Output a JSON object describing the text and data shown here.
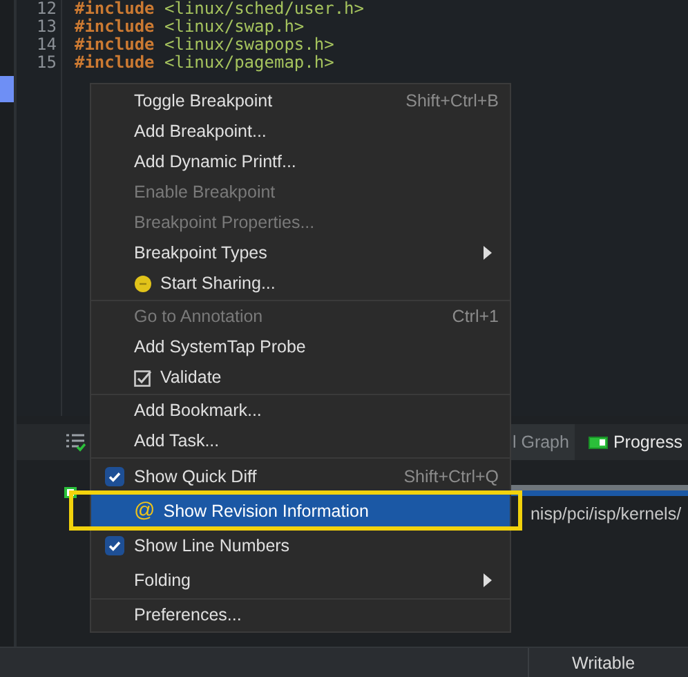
{
  "code_lines": [
    {
      "number": "12",
      "keyword": "#include",
      "path": "<linux/sched/user.h>"
    },
    {
      "number": "13",
      "keyword": "#include",
      "path": "<linux/swap.h>"
    },
    {
      "number": "14",
      "keyword": "#include",
      "path": "<linux/swapops.h>"
    },
    {
      "number": "15",
      "keyword": "#include",
      "path": "<linux/pagemap.h>"
    }
  ],
  "bottom_panel": {
    "tabs": [
      {
        "label": "l Graph",
        "selected": false
      },
      {
        "label": "Progress",
        "selected": true,
        "icon": true
      }
    ],
    "path": "nisp/pci/isp/kernels/"
  },
  "context_menu": [
    {
      "kind": "item",
      "label": "Toggle Breakpoint",
      "shortcut": "Shift+Ctrl+B",
      "disabled": false,
      "selected": false
    },
    {
      "kind": "item",
      "label": "Add Breakpoint...",
      "disabled": false,
      "selected": false
    },
    {
      "kind": "item",
      "label": "Add Dynamic Printf...",
      "disabled": false,
      "selected": false
    },
    {
      "kind": "item",
      "label": "Enable Breakpoint",
      "disabled": true,
      "selected": false
    },
    {
      "kind": "item",
      "label": "Breakpoint Properties...",
      "disabled": true,
      "selected": false
    },
    {
      "kind": "submenu",
      "label": "Breakpoint Types",
      "disabled": false,
      "selected": false
    },
    {
      "kind": "sharing",
      "label": "Start Sharing...",
      "disabled": false,
      "selected": false,
      "separator_after": true
    },
    {
      "kind": "item",
      "label": "Go to Annotation",
      "shortcut": "Ctrl+1",
      "disabled": true,
      "selected": false
    },
    {
      "kind": "item",
      "label": "Add SystemTap Probe",
      "disabled": false,
      "selected": false
    },
    {
      "kind": "validate",
      "label": "Validate",
      "disabled": false,
      "selected": false,
      "separator_after": true
    },
    {
      "kind": "item",
      "label": "Add Bookmark...",
      "disabled": false,
      "selected": false
    },
    {
      "kind": "item",
      "label": "Add Task...",
      "disabled": false,
      "selected": false,
      "separator_after": true
    },
    {
      "kind": "check",
      "label": "Show Quick Diff",
      "shortcut": "Shift+Ctrl+Q",
      "checked": true,
      "disabled": false,
      "selected": false
    },
    {
      "kind": "glyph",
      "glyph": "@",
      "label": "Show Revision Information",
      "disabled": false,
      "selected": true
    },
    {
      "kind": "check",
      "label": "Show Line Numbers",
      "checked": true,
      "disabled": false,
      "selected": false
    },
    {
      "kind": "submenu",
      "label": "Folding",
      "disabled": false,
      "selected": false,
      "separator_after": true
    },
    {
      "kind": "item",
      "label": "Preferences...",
      "disabled": false,
      "selected": false
    }
  ],
  "status_bar": {
    "mode": "Writable"
  }
}
